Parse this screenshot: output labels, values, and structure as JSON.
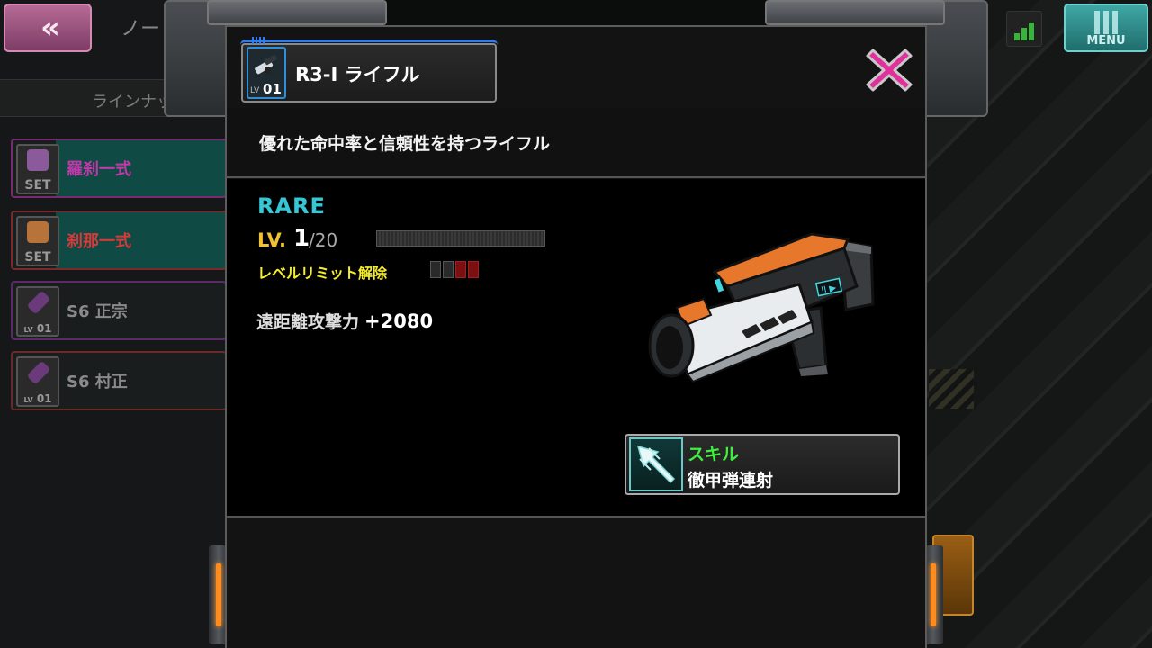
{
  "background": {
    "back_button_glyph": "«",
    "tab_label": "ノー",
    "lineup_label": "ラインナップ",
    "menu_label": "MENU",
    "side_items": [
      {
        "name": "羅刹一式",
        "sub": "SET",
        "name_color": "#c03aa8"
      },
      {
        "name": "刹那一式",
        "sub": "SET",
        "name_color": "#d83a3a"
      },
      {
        "name": "S6 正宗",
        "lv_label": "LV",
        "lv": "01",
        "name_color": "#8a8a8a"
      },
      {
        "name": "S6 村正",
        "lv_label": "LV",
        "lv": "01",
        "name_color": "#8a8a8a"
      }
    ]
  },
  "modal": {
    "item": {
      "title": "R3-I ライフル",
      "icon": "rifle-icon",
      "lv_label": "LV",
      "lv": "01",
      "description": "優れた命中率と信頼性を持つライフル"
    },
    "rarity": "RARE",
    "level": {
      "label": "LV.",
      "current": "1",
      "max": "/20",
      "exp_fraction": 0
    },
    "limit_break": {
      "label": "レベルリミット解除",
      "total": 4,
      "unlocked": 2
    },
    "stat": {
      "label": "遠距離攻撃力",
      "value": "+2080"
    },
    "skill": {
      "label": "スキル",
      "name": "徹甲弾連射",
      "icon": "piercing-shot-icon"
    },
    "close_icon": "close-x-icon"
  },
  "colors": {
    "rarity": "#34c8d6",
    "level_label": "#f2c130",
    "limit_label": "#f5ee2a",
    "skill_label": "#3ef03e",
    "close_x": "#e0309c",
    "header_accent": "#2d7df0"
  }
}
